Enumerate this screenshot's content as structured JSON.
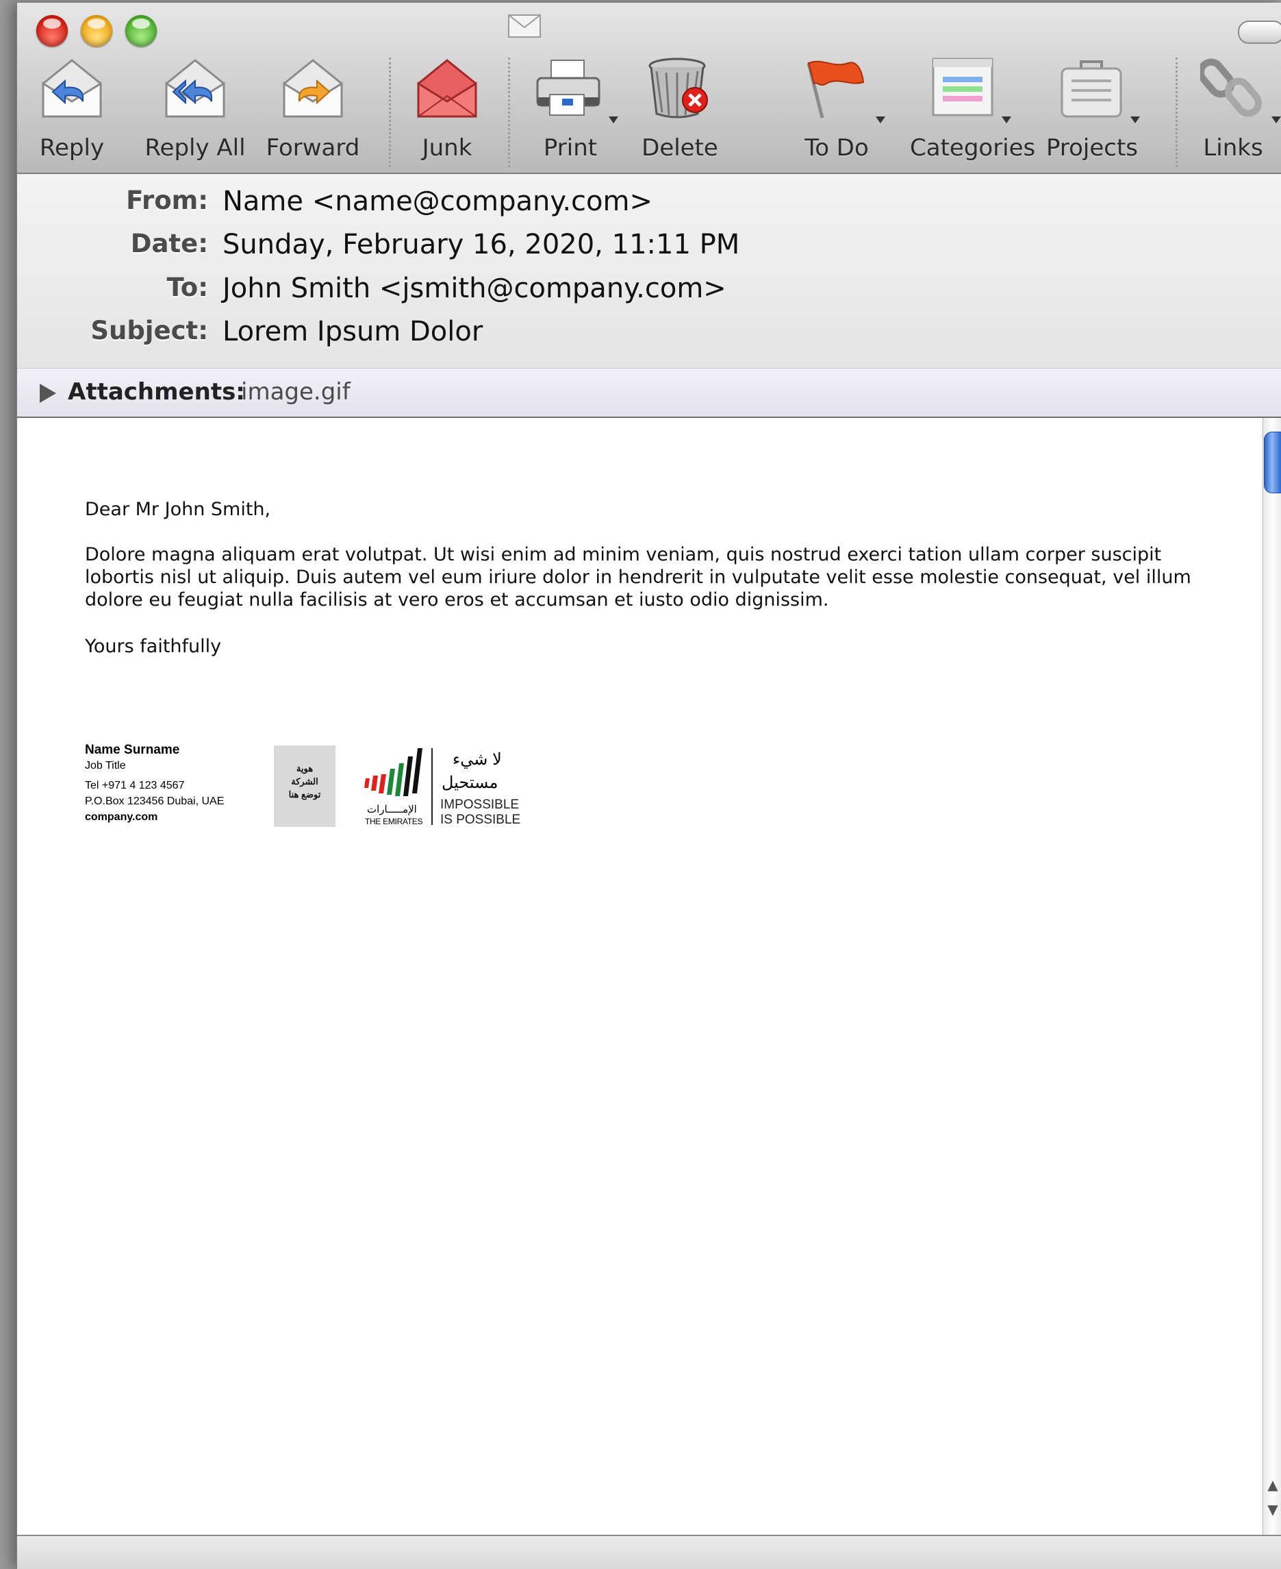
{
  "toolbar": {
    "reply": "Reply",
    "reply_all": "Reply All",
    "forward": "Forward",
    "junk": "Junk",
    "print": "Print",
    "delete": "Delete",
    "todo": "To Do",
    "categories": "Categories",
    "projects": "Projects",
    "links": "Links"
  },
  "headers": {
    "from_label": "From:",
    "from_value": "Name <name@company.com>",
    "date_label": "Date:",
    "date_value": "Sunday, February 16, 2020, 11:11 PM",
    "to_label": "To:",
    "to_value": "John Smith <jsmith@company.com>",
    "subject_label": "Subject:",
    "subject_value": "Lorem Ipsum Dolor"
  },
  "attachments": {
    "label": "Attachments:",
    "file": "image.gif"
  },
  "message": {
    "greeting": "Dear Mr John Smith,",
    "paragraph": "Dolore magna aliquam erat volutpat. Ut wisi enim ad minim veniam, quis nostrud exerci tation ullam corper suscipit lobortis nisl ut aliquip. Duis autem vel eum iriure dolor in hendrerit in vulputate velit esse molestie consequat, vel illum dolore eu feugiat nulla facilisis at vero eros et accumsan et iusto odio dignissim.",
    "closing": "Yours faithfully"
  },
  "signature": {
    "name": "Name Surname",
    "job_title": "Job Title",
    "tel": "Tel +971 4 123 4567",
    "po_box": "P.O.Box  123456 Dubai, UAE",
    "website": "company.com",
    "logo_placeholder_line1": "هوية",
    "logo_placeholder_line2": "الشركة",
    "logo_placeholder_line3": "توضع هنا",
    "emirates_ar": "الإمـــــارات",
    "emirates_en": "THE EMIRATES",
    "slogan_ar_line1": "لا شيء",
    "slogan_ar_line2": "مستحيل",
    "slogan_en_line1": "IMPOSSIBLE",
    "slogan_en_line2": "IS POSSIBLE"
  },
  "colors": {
    "flag_red": "#e0201a",
    "flag_green": "#1a8a3a",
    "accent_blue": "#2d6ad0",
    "junk_red": "#e05050"
  },
  "icons": [
    "reply-icon",
    "reply-all-icon",
    "forward-icon",
    "junk-icon",
    "print-icon",
    "delete-icon",
    "flag-icon",
    "categories-icon",
    "projects-icon",
    "links-icon"
  ]
}
